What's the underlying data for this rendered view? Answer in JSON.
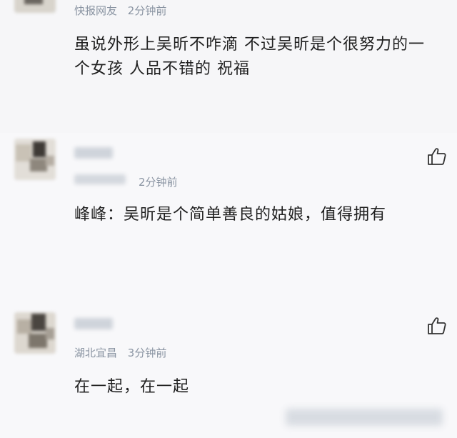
{
  "comments": [
    {
      "username": "快报网友",
      "time": "2分钟前",
      "text": "虽说外形上吴昕不咋滴 不过吴昕是个很努力的一个女孩 人品不错的 祝福"
    },
    {
      "username": "",
      "time": "2分钟前",
      "text": "峰峰：吴昕是个简单善良的姑娘，值得拥有",
      "like_icon": "thumbs-up-icon"
    },
    {
      "username": "",
      "location": "湖北宜昌",
      "time": "3分钟前",
      "text": "在一起，在一起",
      "like_icon": "thumbs-up-icon"
    }
  ],
  "colors": {
    "background": "#f7f7f9",
    "meta_text": "#8a94a2",
    "body_text": "#1f1f1f"
  }
}
